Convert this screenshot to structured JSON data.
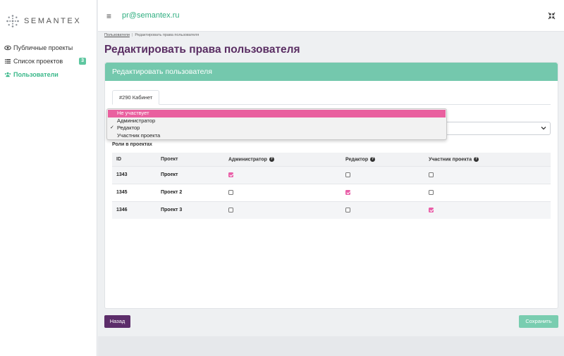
{
  "brand": {
    "name": "SEMANTEX"
  },
  "sidebar": {
    "items": [
      {
        "label": "Публичные проекты",
        "icon": "eye-icon"
      },
      {
        "label": "Список проектов",
        "icon": "list-icon",
        "badge": "3"
      },
      {
        "label": "Пользователи",
        "icon": "users-icon",
        "active": true
      }
    ]
  },
  "header": {
    "email": "pr@semantex.ru"
  },
  "breadcrumb": {
    "link": "Пользователи",
    "separator": "|",
    "current": "Редактировать права пользователя"
  },
  "page": {
    "title": "Редактировать права пользователя"
  },
  "card": {
    "header": "Редактировать пользователя",
    "tab": "#290 Кабинет",
    "section_label": "Роли в проектах"
  },
  "dropdown": {
    "options": [
      {
        "label": "Не участвует",
        "highlighted": true,
        "checked": false
      },
      {
        "label": "Администратор",
        "highlighted": false,
        "checked": false
      },
      {
        "label": "Редактор",
        "highlighted": false,
        "checked": true
      },
      {
        "label": "Участник проекта",
        "highlighted": false,
        "checked": false
      }
    ]
  },
  "table": {
    "headers": {
      "id": "ID",
      "project": "Проект",
      "admin": "Администратор",
      "editor": "Редактор",
      "member": "Участник проекта"
    },
    "rows": [
      {
        "id": "1343",
        "project": "Проект",
        "admin": true,
        "editor": false,
        "member": false
      },
      {
        "id": "1345",
        "project": "Проект 2",
        "admin": false,
        "editor": true,
        "member": false
      },
      {
        "id": "1346",
        "project": "Проект 3",
        "admin": false,
        "editor": false,
        "member": true
      }
    ]
  },
  "buttons": {
    "back": "Назад",
    "save": "Сохранить"
  },
  "colors": {
    "brand_purple": "#5a2e63",
    "accent_green": "#74c8ad",
    "check_pink": "#e95fa8"
  }
}
